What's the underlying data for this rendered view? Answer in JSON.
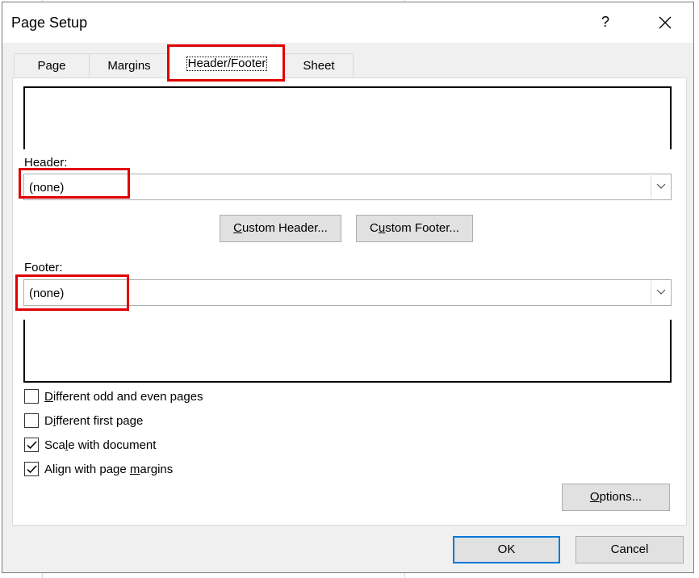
{
  "dialog": {
    "title": "Page Setup",
    "help_label": "?",
    "close_icon": "close-icon"
  },
  "tabs": [
    {
      "label": "Page",
      "active": false
    },
    {
      "label": "Margins",
      "active": false
    },
    {
      "label": "Header/Footer",
      "active": true
    },
    {
      "label": "Sheet",
      "active": false
    }
  ],
  "header": {
    "label": "Header:",
    "value": "(none)",
    "custom_button": {
      "pre": "",
      "key": "C",
      "post": "ustom Header..."
    }
  },
  "footer": {
    "label": "Footer:",
    "value": "(none)",
    "custom_button": {
      "pre": "C",
      "key": "u",
      "post": "stom Footer..."
    }
  },
  "options": [
    {
      "pre": "",
      "key": "D",
      "post": "ifferent odd and even pages",
      "checked": false
    },
    {
      "pre": "D",
      "key": "i",
      "post": "fferent first page",
      "checked": false
    },
    {
      "pre": "Sca",
      "key": "l",
      "post": "e with document",
      "checked": true
    },
    {
      "pre": "Align with page ",
      "key": "m",
      "post": "argins",
      "checked": true
    }
  ],
  "buttons": {
    "options": {
      "pre": "",
      "key": "O",
      "post": "ptions..."
    },
    "ok": "OK",
    "cancel": "Cancel"
  },
  "colors": {
    "highlight": "#e00000",
    "ok_border": "#0078d7",
    "dialog_bg": "#f0f0f0"
  }
}
